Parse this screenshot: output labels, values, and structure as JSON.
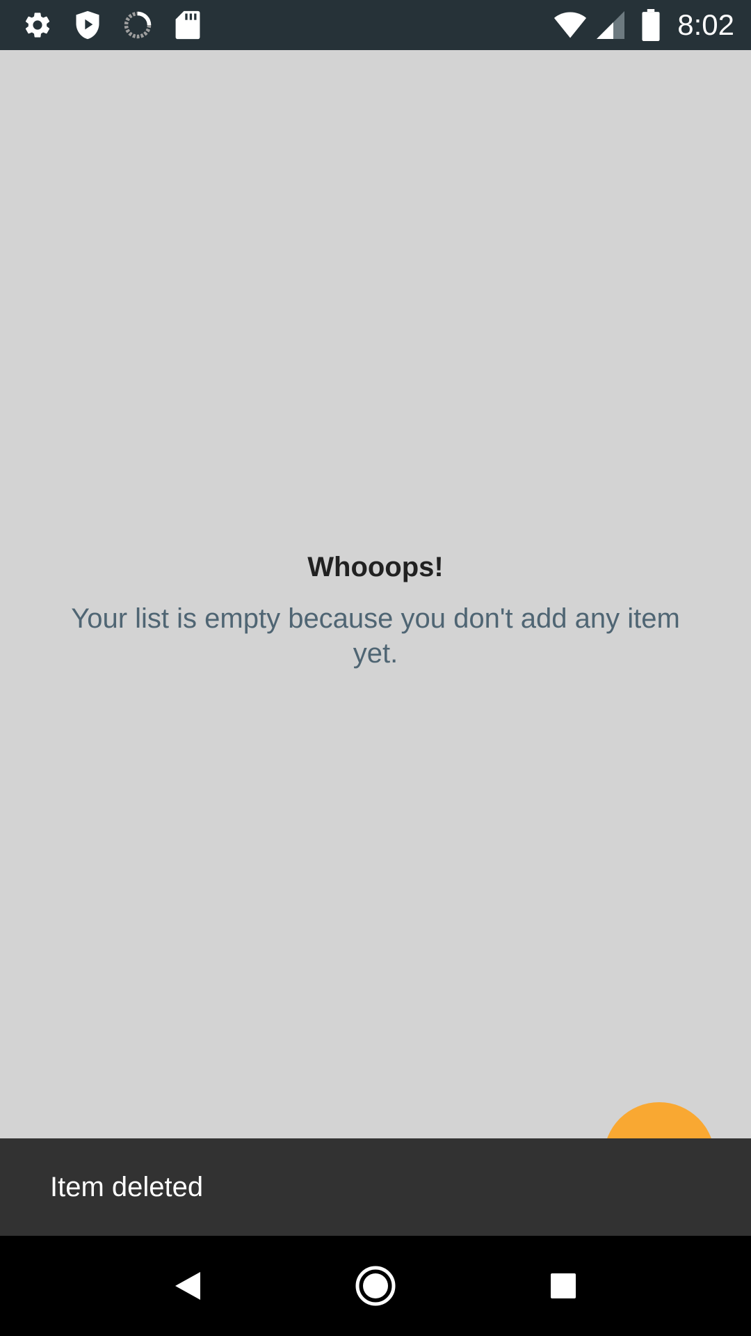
{
  "status_bar": {
    "time": "8:02",
    "left_icons": [
      "gear-icon",
      "shield-play-icon",
      "sync-spinner-icon",
      "sd-card-icon"
    ],
    "right_icons": [
      "wifi-icon",
      "cellular-signal-icon",
      "battery-icon"
    ],
    "background_color": "#263238"
  },
  "empty_state": {
    "title": "Whooops!",
    "message": "Your list is empty because you don't add any item yet."
  },
  "fab": {
    "color": "#f9a832"
  },
  "snackbar": {
    "text": "Item deleted",
    "background_color": "#323232"
  },
  "nav_bar": {
    "buttons": [
      "back-icon",
      "home-icon",
      "recents-icon"
    ]
  },
  "colors": {
    "background": "#d3d3d3",
    "message_text": "#4f6573"
  }
}
